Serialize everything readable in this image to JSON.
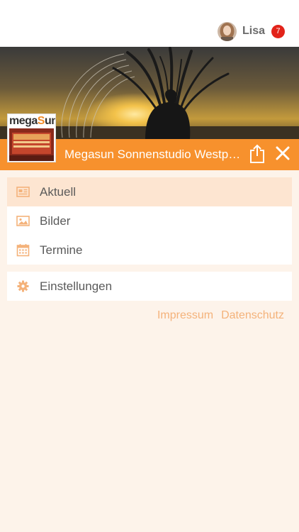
{
  "header": {
    "user_name": "Lisa",
    "notification_count": "7"
  },
  "studio": {
    "logo_brand_pre": "mega",
    "logo_brand_five": "S",
    "logo_brand_post": "un",
    "title": "Megasun Sonnenstudio Westpark"
  },
  "menu": {
    "items": [
      {
        "label": "Aktuell",
        "icon": "newspaper-icon",
        "active": true
      },
      {
        "label": "Bilder",
        "icon": "image-icon",
        "active": false
      },
      {
        "label": "Termine",
        "icon": "calendar-icon",
        "active": false
      }
    ],
    "settings_label": "Einstellungen",
    "settings_icon": "gear-icon"
  },
  "footer_links": {
    "impressum": "Impressum",
    "datenschutz": "Datenschutz"
  },
  "colors": {
    "accent": "#f7912d",
    "active_row": "#fde5d1",
    "background": "#fdf3ea",
    "badge": "#e2231a",
    "link": "#f4b27a"
  }
}
